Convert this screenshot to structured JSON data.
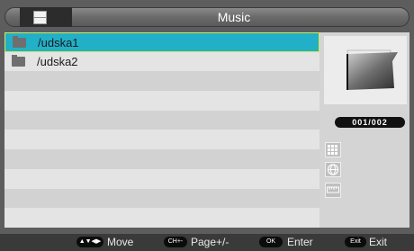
{
  "header": {
    "title": "Music",
    "icon": "media-icon"
  },
  "list": {
    "items": [
      {
        "label": "/udska1",
        "icon": "folder-icon",
        "selected": true
      },
      {
        "label": "/udska2",
        "icon": "folder-icon",
        "selected": false
      }
    ],
    "row_count": 10
  },
  "panel": {
    "counter": "001/002",
    "icons": [
      "grid-icon",
      "globe-icon",
      "ruler-icon"
    ]
  },
  "footer": {
    "hints": [
      {
        "key": "▲▼◀▶",
        "label": "Move"
      },
      {
        "key": "CH+-",
        "label": "Page+/-"
      },
      {
        "key": "OK",
        "label": "Enter"
      },
      {
        "key": "Exit",
        "label": "Exit"
      }
    ]
  },
  "colors": {
    "selected_row": "#22b0c8",
    "selected_border": "#d9e650",
    "panel": "#d4d4d4"
  }
}
